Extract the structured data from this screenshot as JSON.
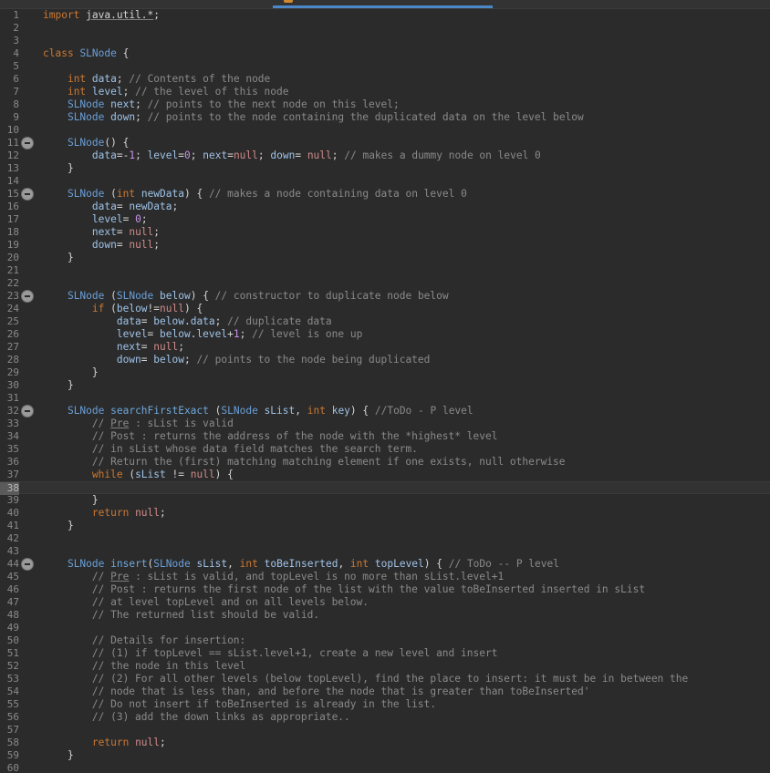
{
  "editor": {
    "language": "java",
    "current_line": 38,
    "colors": {
      "background": "#2b2b2b",
      "keyword": "#cc7832",
      "type": "#6a9fd8",
      "identifier": "#9fc3e8",
      "number": "#c792ea",
      "null_literal": "#d08a8a",
      "comment": "#8a8a8a",
      "tab_accent": "#4a88c7"
    },
    "icons": {
      "fold": "collapse-minus-icon"
    },
    "lines": [
      {
        "n": "1",
        "fold": false,
        "tokens": [
          [
            "kw",
            "import"
          ],
          [
            "p",
            " "
          ],
          [
            "imp",
            "java.util.*"
          ],
          [
            "p",
            ";"
          ]
        ]
      },
      {
        "n": "2",
        "fold": false,
        "tokens": []
      },
      {
        "n": "3",
        "fold": false,
        "tokens": []
      },
      {
        "n": "4",
        "fold": false,
        "tokens": [
          [
            "kw",
            "class"
          ],
          [
            "p",
            " "
          ],
          [
            "type",
            "SLNode"
          ],
          [
            "p",
            " {"
          ]
        ]
      },
      {
        "n": "5",
        "fold": false,
        "tokens": []
      },
      {
        "n": "6",
        "fold": false,
        "tokens": [
          [
            "p",
            "    "
          ],
          [
            "kw",
            "int"
          ],
          [
            "p",
            " "
          ],
          [
            "id",
            "data"
          ],
          [
            "p",
            "; "
          ],
          [
            "cm",
            "// Contents of the node"
          ]
        ]
      },
      {
        "n": "7",
        "fold": false,
        "tokens": [
          [
            "p",
            "    "
          ],
          [
            "kw",
            "int"
          ],
          [
            "p",
            " "
          ],
          [
            "id",
            "level"
          ],
          [
            "p",
            "; "
          ],
          [
            "cm",
            "// the level of this node"
          ]
        ]
      },
      {
        "n": "8",
        "fold": false,
        "tokens": [
          [
            "p",
            "    "
          ],
          [
            "type",
            "SLNode"
          ],
          [
            "p",
            " "
          ],
          [
            "id",
            "next"
          ],
          [
            "p",
            "; "
          ],
          [
            "cm",
            "// points to the next node on this level;"
          ]
        ]
      },
      {
        "n": "9",
        "fold": false,
        "tokens": [
          [
            "p",
            "    "
          ],
          [
            "type",
            "SLNode"
          ],
          [
            "p",
            " "
          ],
          [
            "id",
            "down"
          ],
          [
            "p",
            "; "
          ],
          [
            "cm",
            "// points to the node containing the duplicated data on the level below"
          ]
        ]
      },
      {
        "n": "10",
        "fold": false,
        "tokens": []
      },
      {
        "n": "11",
        "fold": true,
        "tokens": [
          [
            "p",
            "    "
          ],
          [
            "type",
            "SLNode"
          ],
          [
            "p",
            "() {"
          ]
        ]
      },
      {
        "n": "12",
        "fold": false,
        "tokens": [
          [
            "p",
            "        "
          ],
          [
            "id",
            "data"
          ],
          [
            "p",
            "=-"
          ],
          [
            "num",
            "1"
          ],
          [
            "p",
            "; "
          ],
          [
            "id",
            "level"
          ],
          [
            "p",
            "="
          ],
          [
            "num",
            "0"
          ],
          [
            "p",
            "; "
          ],
          [
            "id",
            "next"
          ],
          [
            "p",
            "="
          ],
          [
            "nul",
            "null"
          ],
          [
            "p",
            "; "
          ],
          [
            "id",
            "down"
          ],
          [
            "p",
            "= "
          ],
          [
            "nul",
            "null"
          ],
          [
            "p",
            "; "
          ],
          [
            "cm",
            "// makes a dummy node on level 0"
          ]
        ]
      },
      {
        "n": "13",
        "fold": false,
        "tokens": [
          [
            "p",
            "    }"
          ]
        ]
      },
      {
        "n": "14",
        "fold": false,
        "tokens": []
      },
      {
        "n": "15",
        "fold": true,
        "tokens": [
          [
            "p",
            "    "
          ],
          [
            "type",
            "SLNode"
          ],
          [
            "p",
            " ("
          ],
          [
            "kw",
            "int"
          ],
          [
            "p",
            " "
          ],
          [
            "id",
            "newData"
          ],
          [
            "p",
            ") { "
          ],
          [
            "cm",
            "// makes a node containing data on level 0"
          ]
        ]
      },
      {
        "n": "16",
        "fold": false,
        "tokens": [
          [
            "p",
            "        "
          ],
          [
            "id",
            "data"
          ],
          [
            "p",
            "= "
          ],
          [
            "id",
            "newData"
          ],
          [
            "p",
            ";"
          ]
        ]
      },
      {
        "n": "17",
        "fold": false,
        "tokens": [
          [
            "p",
            "        "
          ],
          [
            "id",
            "level"
          ],
          [
            "p",
            "= "
          ],
          [
            "num",
            "0"
          ],
          [
            "p",
            ";"
          ]
        ]
      },
      {
        "n": "18",
        "fold": false,
        "tokens": [
          [
            "p",
            "        "
          ],
          [
            "id",
            "next"
          ],
          [
            "p",
            "= "
          ],
          [
            "nul",
            "null"
          ],
          [
            "p",
            ";"
          ]
        ]
      },
      {
        "n": "19",
        "fold": false,
        "tokens": [
          [
            "p",
            "        "
          ],
          [
            "id",
            "down"
          ],
          [
            "p",
            "= "
          ],
          [
            "nul",
            "null"
          ],
          [
            "p",
            ";"
          ]
        ]
      },
      {
        "n": "20",
        "fold": false,
        "tokens": [
          [
            "p",
            "    }"
          ]
        ]
      },
      {
        "n": "21",
        "fold": false,
        "tokens": []
      },
      {
        "n": "22",
        "fold": false,
        "tokens": []
      },
      {
        "n": "23",
        "fold": true,
        "tokens": [
          [
            "p",
            "    "
          ],
          [
            "type",
            "SLNode"
          ],
          [
            "p",
            " ("
          ],
          [
            "type",
            "SLNode"
          ],
          [
            "p",
            " "
          ],
          [
            "id",
            "below"
          ],
          [
            "p",
            ") { "
          ],
          [
            "cm",
            "// constructor to duplicate node below"
          ]
        ]
      },
      {
        "n": "24",
        "fold": false,
        "tokens": [
          [
            "p",
            "        "
          ],
          [
            "kw",
            "if"
          ],
          [
            "p",
            " ("
          ],
          [
            "id",
            "below"
          ],
          [
            "p",
            "!="
          ],
          [
            "nul",
            "null"
          ],
          [
            "p",
            ") {"
          ]
        ]
      },
      {
        "n": "25",
        "fold": false,
        "tokens": [
          [
            "p",
            "            "
          ],
          [
            "id",
            "data"
          ],
          [
            "p",
            "= "
          ],
          [
            "id",
            "below"
          ],
          [
            "p",
            "."
          ],
          [
            "id",
            "data"
          ],
          [
            "p",
            "; "
          ],
          [
            "cm",
            "// duplicate data"
          ]
        ]
      },
      {
        "n": "26",
        "fold": false,
        "tokens": [
          [
            "p",
            "            "
          ],
          [
            "id",
            "level"
          ],
          [
            "p",
            "= "
          ],
          [
            "id",
            "below"
          ],
          [
            "p",
            "."
          ],
          [
            "id",
            "level"
          ],
          [
            "p",
            "+"
          ],
          [
            "num",
            "1"
          ],
          [
            "p",
            "; "
          ],
          [
            "cm",
            "// level is one up"
          ]
        ]
      },
      {
        "n": "27",
        "fold": false,
        "tokens": [
          [
            "p",
            "            "
          ],
          [
            "id",
            "next"
          ],
          [
            "p",
            "= "
          ],
          [
            "nul",
            "null"
          ],
          [
            "p",
            ";"
          ]
        ]
      },
      {
        "n": "28",
        "fold": false,
        "tokens": [
          [
            "p",
            "            "
          ],
          [
            "id",
            "down"
          ],
          [
            "p",
            "= "
          ],
          [
            "id",
            "below"
          ],
          [
            "p",
            "; "
          ],
          [
            "cm",
            "// points to the node being duplicated"
          ]
        ]
      },
      {
        "n": "29",
        "fold": false,
        "tokens": [
          [
            "p",
            "        }"
          ]
        ]
      },
      {
        "n": "30",
        "fold": false,
        "tokens": [
          [
            "p",
            "    }"
          ]
        ]
      },
      {
        "n": "31",
        "fold": false,
        "tokens": []
      },
      {
        "n": "32",
        "fold": true,
        "tokens": [
          [
            "p",
            "    "
          ],
          [
            "type",
            "SLNode"
          ],
          [
            "p",
            " "
          ],
          [
            "mth",
            "searchFirstExact"
          ],
          [
            "p",
            " ("
          ],
          [
            "type",
            "SLNode"
          ],
          [
            "p",
            " "
          ],
          [
            "id",
            "sList"
          ],
          [
            "p",
            ", "
          ],
          [
            "kw",
            "int"
          ],
          [
            "p",
            " "
          ],
          [
            "id",
            "key"
          ],
          [
            "p",
            ") { "
          ],
          [
            "cm",
            "//ToDo - P level"
          ]
        ]
      },
      {
        "n": "33",
        "fold": false,
        "tokens": [
          [
            "p",
            "        "
          ],
          [
            "cm",
            "// "
          ],
          [
            "cmu",
            "Pre"
          ],
          [
            "cm",
            " : sList is valid"
          ]
        ]
      },
      {
        "n": "34",
        "fold": false,
        "tokens": [
          [
            "p",
            "        "
          ],
          [
            "cm",
            "// Post : returns the address of the node with the *highest* level"
          ]
        ]
      },
      {
        "n": "35",
        "fold": false,
        "tokens": [
          [
            "p",
            "        "
          ],
          [
            "cm",
            "// in sList whose data field matches the search term."
          ]
        ]
      },
      {
        "n": "36",
        "fold": false,
        "tokens": [
          [
            "p",
            "        "
          ],
          [
            "cm",
            "// Return the (first) matching matching element if one exists, null otherwise"
          ]
        ]
      },
      {
        "n": "37",
        "fold": false,
        "tokens": [
          [
            "p",
            "        "
          ],
          [
            "kw",
            "while"
          ],
          [
            "p",
            " ("
          ],
          [
            "id",
            "sList"
          ],
          [
            "p",
            " != "
          ],
          [
            "nul",
            "null"
          ],
          [
            "p",
            ") {"
          ]
        ]
      },
      {
        "n": "38",
        "fold": false,
        "current": true,
        "tokens": []
      },
      {
        "n": "39",
        "fold": false,
        "tokens": [
          [
            "p",
            "        }"
          ]
        ]
      },
      {
        "n": "40",
        "fold": false,
        "tokens": [
          [
            "p",
            "        "
          ],
          [
            "kw",
            "return"
          ],
          [
            "p",
            " "
          ],
          [
            "nul",
            "null"
          ],
          [
            "p",
            ";"
          ]
        ]
      },
      {
        "n": "41",
        "fold": false,
        "tokens": [
          [
            "p",
            "    }"
          ]
        ]
      },
      {
        "n": "42",
        "fold": false,
        "tokens": []
      },
      {
        "n": "43",
        "fold": false,
        "tokens": []
      },
      {
        "n": "44",
        "fold": true,
        "tokens": [
          [
            "p",
            "    "
          ],
          [
            "type",
            "SLNode"
          ],
          [
            "p",
            " "
          ],
          [
            "mth",
            "insert"
          ],
          [
            "p",
            "("
          ],
          [
            "type",
            "SLNode"
          ],
          [
            "p",
            " "
          ],
          [
            "id",
            "sList"
          ],
          [
            "p",
            ", "
          ],
          [
            "kw",
            "int"
          ],
          [
            "p",
            " "
          ],
          [
            "id",
            "toBeInserted"
          ],
          [
            "p",
            ", "
          ],
          [
            "kw",
            "int"
          ],
          [
            "p",
            " "
          ],
          [
            "id",
            "topLevel"
          ],
          [
            "p",
            ") { "
          ],
          [
            "cm",
            "// ToDo -- P level"
          ]
        ]
      },
      {
        "n": "45",
        "fold": false,
        "tokens": [
          [
            "p",
            "        "
          ],
          [
            "cm",
            "// "
          ],
          [
            "cmu",
            "Pre"
          ],
          [
            "cm",
            " : sList is valid, and topLevel is no more than sList.level+1"
          ]
        ]
      },
      {
        "n": "46",
        "fold": false,
        "tokens": [
          [
            "p",
            "        "
          ],
          [
            "cm",
            "// Post : returns the first node of the list with the value toBeInserted inserted in sList"
          ]
        ]
      },
      {
        "n": "47",
        "fold": false,
        "tokens": [
          [
            "p",
            "        "
          ],
          [
            "cm",
            "// at level topLevel and on all levels below."
          ]
        ]
      },
      {
        "n": "48",
        "fold": false,
        "tokens": [
          [
            "p",
            "        "
          ],
          [
            "cm",
            "// The returned list should be valid."
          ]
        ]
      },
      {
        "n": "49",
        "fold": false,
        "tokens": []
      },
      {
        "n": "50",
        "fold": false,
        "tokens": [
          [
            "p",
            "        "
          ],
          [
            "cm",
            "// Details for insertion:"
          ]
        ]
      },
      {
        "n": "51",
        "fold": false,
        "tokens": [
          [
            "p",
            "        "
          ],
          [
            "cm",
            "// (1) if topLevel == sList.level+1, create a new level and insert"
          ]
        ]
      },
      {
        "n": "52",
        "fold": false,
        "tokens": [
          [
            "p",
            "        "
          ],
          [
            "cm",
            "// the node in this level"
          ]
        ]
      },
      {
        "n": "53",
        "fold": false,
        "tokens": [
          [
            "p",
            "        "
          ],
          [
            "cm",
            "// (2) For all other levels (below topLevel), find the place to insert: it must be in between the"
          ]
        ]
      },
      {
        "n": "54",
        "fold": false,
        "tokens": [
          [
            "p",
            "        "
          ],
          [
            "cm",
            "// node that is less than, and before the node that is greater than toBeInserted'"
          ]
        ]
      },
      {
        "n": "55",
        "fold": false,
        "tokens": [
          [
            "p",
            "        "
          ],
          [
            "cm",
            "// Do not insert if toBeInserted is already in the list."
          ]
        ]
      },
      {
        "n": "56",
        "fold": false,
        "tokens": [
          [
            "p",
            "        "
          ],
          [
            "cm",
            "// (3) add the down links as appropriate.."
          ]
        ]
      },
      {
        "n": "57",
        "fold": false,
        "tokens": []
      },
      {
        "n": "58",
        "fold": false,
        "tokens": [
          [
            "p",
            "        "
          ],
          [
            "kw",
            "return"
          ],
          [
            "p",
            " "
          ],
          [
            "nul",
            "null"
          ],
          [
            "p",
            ";"
          ]
        ]
      },
      {
        "n": "59",
        "fold": false,
        "tokens": [
          [
            "p",
            "    }"
          ]
        ]
      },
      {
        "n": "60",
        "fold": false,
        "tokens": []
      }
    ]
  }
}
